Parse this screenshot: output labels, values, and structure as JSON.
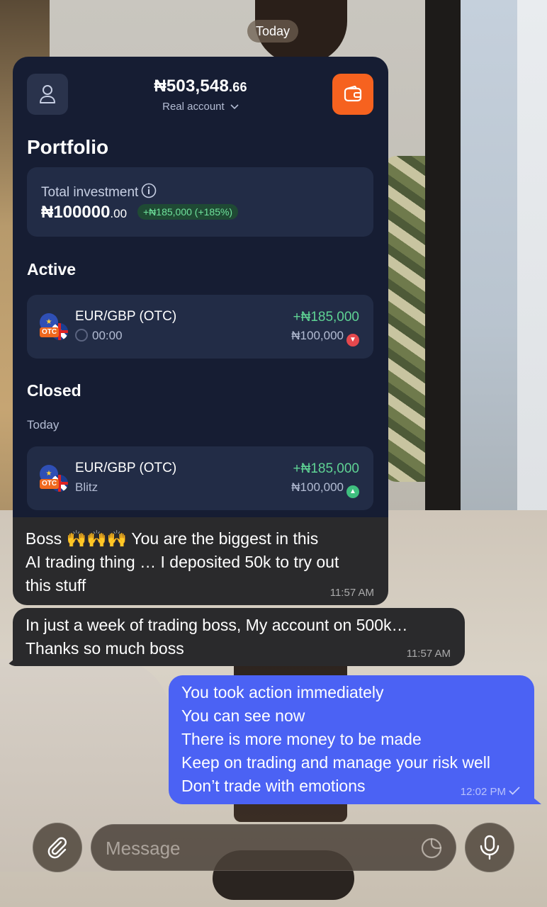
{
  "chat": {
    "date_separator": "Today"
  },
  "embedded_screenshot": {
    "balance_main": "₦503,548",
    "balance_decimals": ".66",
    "account_type": "Real account",
    "portfolio_title": "Portfolio",
    "total_investment_label": "Total investment",
    "total_investment_main": "₦100000",
    "total_investment_decimals": ".00",
    "total_gain_badge": "+₦185,000 (+185%)",
    "active_title": "Active",
    "active_trade": {
      "pair": "EUR/GBP (OTC)",
      "timer": "00:00",
      "profit": "+₦185,000",
      "stake": "₦100,000",
      "direction": "down",
      "direction_color": "#e5484d"
    },
    "closed_title": "Closed",
    "closed_date_group": "Today",
    "closed_trade": {
      "pair": "EUR/GBP (OTC)",
      "mode": "Blitz",
      "profit": "+₦185,000",
      "stake": "₦100,000",
      "direction": "up",
      "direction_color": "#3fbf7f"
    },
    "otc_badge": "OTC",
    "accent_color": "#f6621f"
  },
  "messages": [
    {
      "direction": "incoming",
      "lines": [
        "Boss 🙌🙌🙌 You are the biggest in this",
        "AI trading thing … I deposited 50k to try out",
        "this stuff"
      ],
      "time": "11:57 AM"
    },
    {
      "direction": "incoming",
      "lines": [
        "In just a week of trading boss, My account on 500k…",
        "Thanks so much boss"
      ],
      "time": "11:57 AM"
    },
    {
      "direction": "outgoing",
      "lines": [
        "You took action immediately",
        "You can see now",
        "There is more money to be made",
        "Keep on trading and manage your risk well",
        "Don’t trade with emotions"
      ],
      "time": "12:02 PM",
      "status_icon": "check-icon"
    }
  ],
  "composer": {
    "placeholder": "Message",
    "attach_icon": "paperclip-icon",
    "sticker_icon": "sticker-icon",
    "mic_icon": "microphone-icon"
  },
  "colors": {
    "incoming_bubble": "#2a2a2c",
    "outgoing_bubble": "#4b62f4",
    "profit_green": "#5fd394"
  }
}
